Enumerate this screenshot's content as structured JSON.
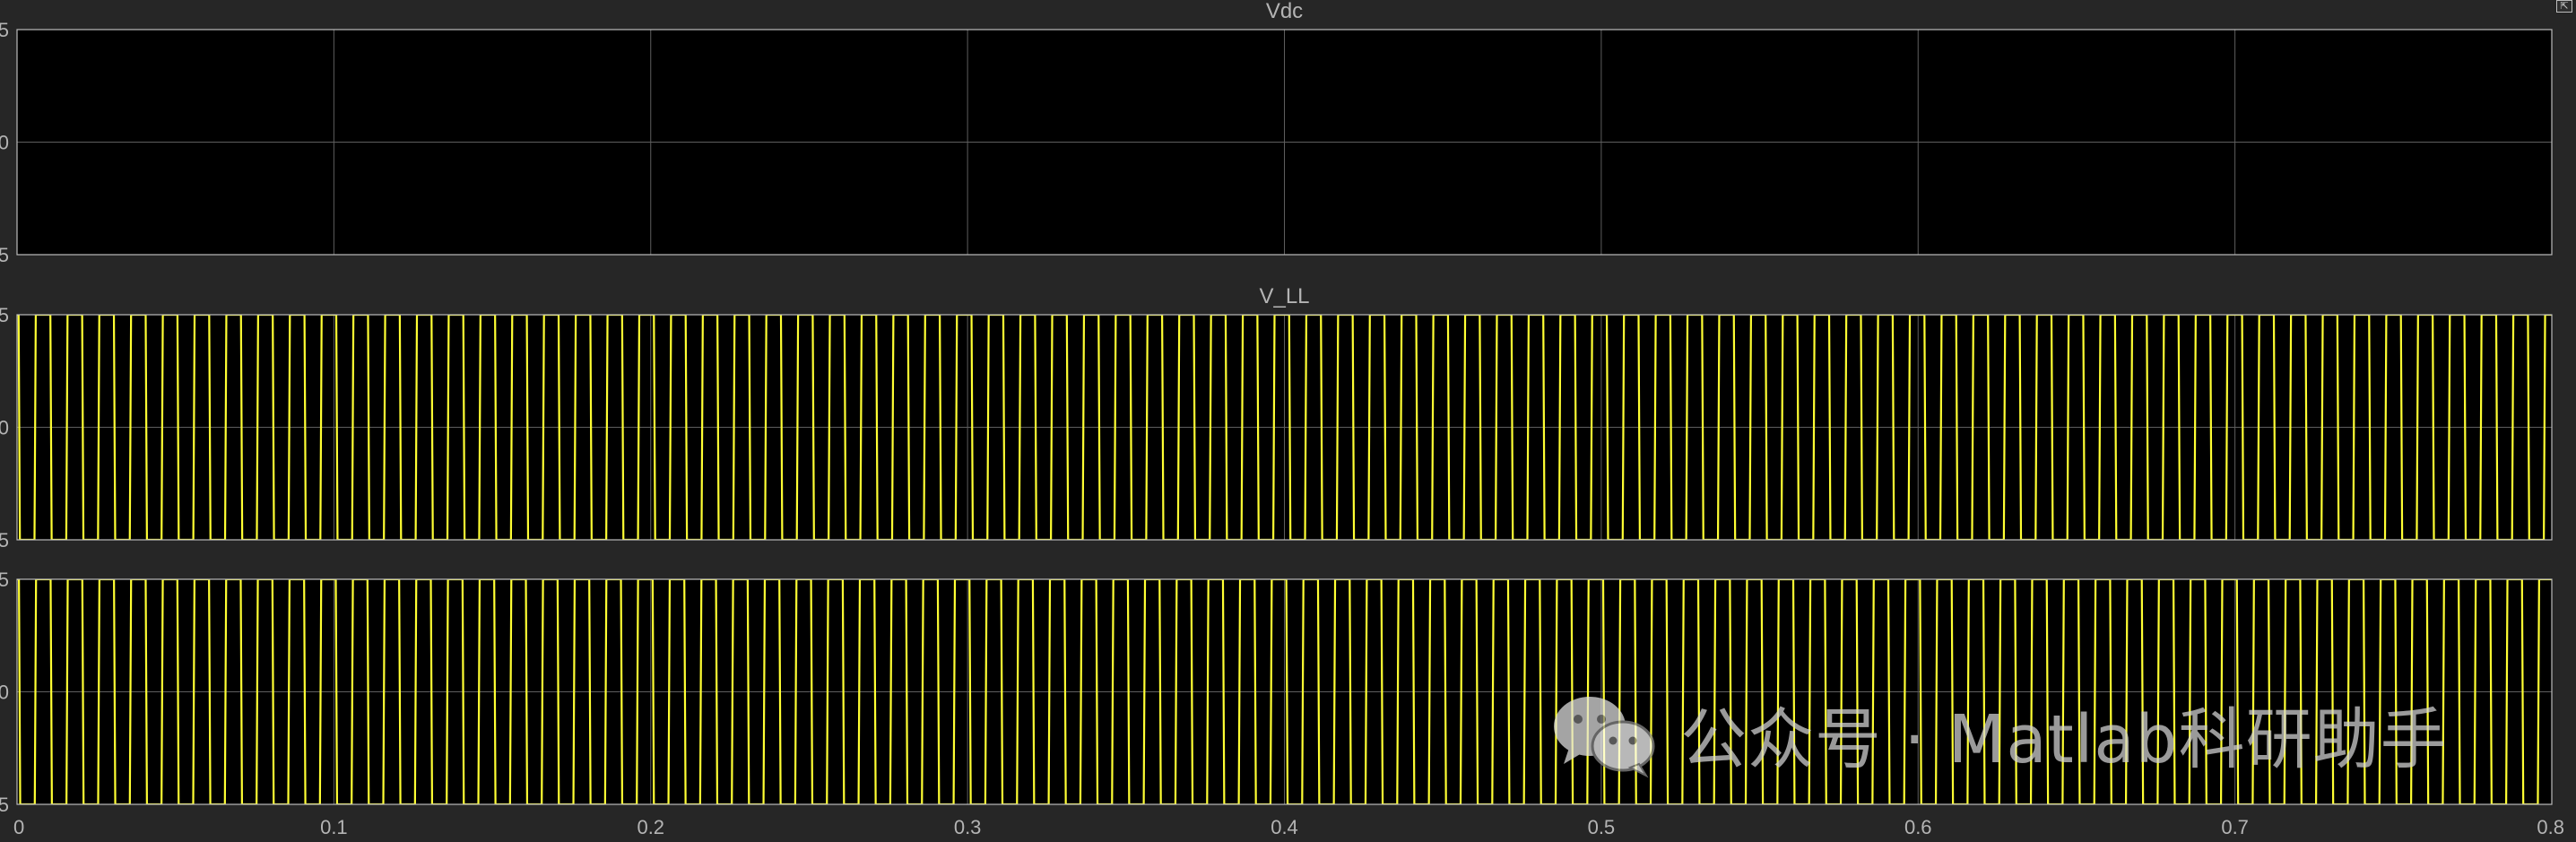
{
  "chart_data": [
    {
      "type": "line",
      "title": "Vdc",
      "xlim": [
        0,
        0.8
      ],
      "ylim": [
        -5,
        5
      ],
      "y_ticks": [
        "5",
        "0",
        "5"
      ],
      "x_tick_labels_shown": false,
      "grid": true,
      "series": [
        {
          "x": [],
          "y": []
        }
      ]
    },
    {
      "type": "line",
      "title": "V_LL",
      "xlim": [
        0,
        0.8
      ],
      "ylim": [
        -5,
        5
      ],
      "y_ticks": [
        "5",
        "0",
        "5"
      ],
      "x_tick_labels_shown": false,
      "grid": true,
      "waveform": "square",
      "series": [
        {
          "start_level": 5,
          "first_edge": 0.0005,
          "edge_spacing": 0.0050125,
          "y_low": -5,
          "y_high": 5
        }
      ]
    },
    {
      "type": "line",
      "title": "",
      "xlim": [
        0,
        0.8
      ],
      "ylim": [
        -5,
        5
      ],
      "y_ticks": [
        "5",
        "0",
        "5"
      ],
      "x_ticks": [
        0,
        0.1,
        0.2,
        0.3,
        0.4,
        0.5,
        0.6,
        0.7,
        0.8
      ],
      "x_tick_labels": [
        "0",
        "0.1",
        "0.2",
        "0.3",
        "0.4",
        "0.5",
        "0.6",
        "0.7",
        "0.8"
      ],
      "x_tick_labels_shown": true,
      "grid": true,
      "waveform": "square",
      "series": [
        {
          "start_level": 5,
          "first_edge": 0.0006,
          "edge_spacing": 0.005,
          "y_low": -5,
          "y_high": 5
        }
      ]
    }
  ],
  "colors": {
    "background": "#262626",
    "axes_background": "#000000",
    "grid": "#5e5e5e",
    "axes_border": "#bcbcbc",
    "text": "#b4b4b4",
    "signal": "#ffff33"
  },
  "watermark": {
    "text": "公众号 · Matlab科研助手",
    "icon": "wechat-icon"
  },
  "corner_button": {
    "label": "⇱",
    "icon": "restore-icon"
  }
}
